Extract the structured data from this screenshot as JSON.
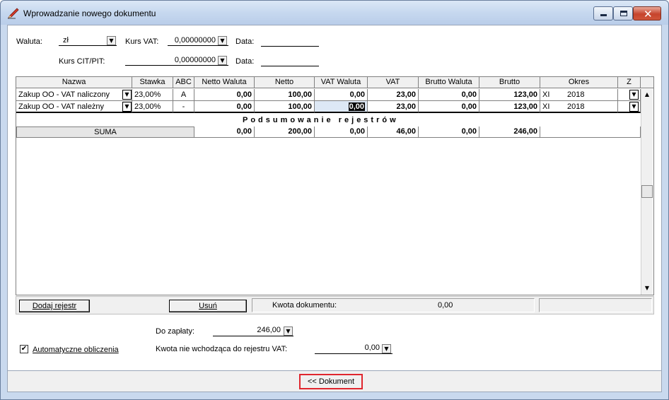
{
  "window": {
    "title": "Wprowadzanie nowego dokumentu"
  },
  "header": {
    "waluta_label": "Waluta:",
    "waluta_value": "zł",
    "kurs_vat_label": "Kurs VAT:",
    "kurs_vat_value": "0,00000000",
    "data1_label": "Data:",
    "kurs_cit_label": "Kurs CIT/PIT:",
    "kurs_cit_value": "0,00000000",
    "data2_label": "Data:"
  },
  "grid": {
    "columns": [
      "Nazwa",
      "Stawka",
      "ABC",
      "Netto Waluta",
      "Netto",
      "VAT Waluta",
      "VAT",
      "Brutto Waluta",
      "Brutto",
      "Okres",
      "Z"
    ],
    "rows": [
      {
        "nazwa": "Zakup OO - VAT naliczony",
        "stawka": "23,00%",
        "abc": "A",
        "netto_waluta": "0,00",
        "netto": "100,00",
        "vat_waluta": "0,00",
        "vat": "23,00",
        "brutto_waluta": "0,00",
        "brutto": "123,00",
        "okres_m": "XI",
        "okres_y": "2018"
      },
      {
        "nazwa": "Zakup OO - VAT należny",
        "stawka": "23,00%",
        "abc": "-",
        "netto_waluta": "0,00",
        "netto": "100,00",
        "vat_waluta": "0,00",
        "vat": "23,00",
        "brutto_waluta": "0,00",
        "brutto": "123,00",
        "okres_m": "XI",
        "okres_y": "2018"
      }
    ],
    "summary_title": "Podsumowanie rejestrów",
    "summary": {
      "label": "SUMA",
      "netto_waluta": "0,00",
      "netto": "200,00",
      "vat_waluta": "0,00",
      "vat": "46,00",
      "brutto_waluta": "0,00",
      "brutto": "246,00"
    }
  },
  "bottom": {
    "add_button": "Dodaj rejestr",
    "delete_button": "Usuń",
    "kwota_label": "Kwota dokumentu:",
    "kwota_value": "0,00"
  },
  "totals": {
    "do_zaplaty_label": "Do zapłaty:",
    "do_zaplaty_value": "246,00",
    "kwota_nie_label": "Kwota nie wchodząca do rejestru VAT:",
    "kwota_nie_value": "0,00",
    "auto_label": "Automatyczne obliczenia",
    "auto_checked": "✔"
  },
  "footer": {
    "dokument_button": "<< Dokument"
  },
  "glyphs": {
    "dropdown": "▼",
    "scroll_up": "▲",
    "scroll_down": "▼",
    "close": "✕"
  }
}
